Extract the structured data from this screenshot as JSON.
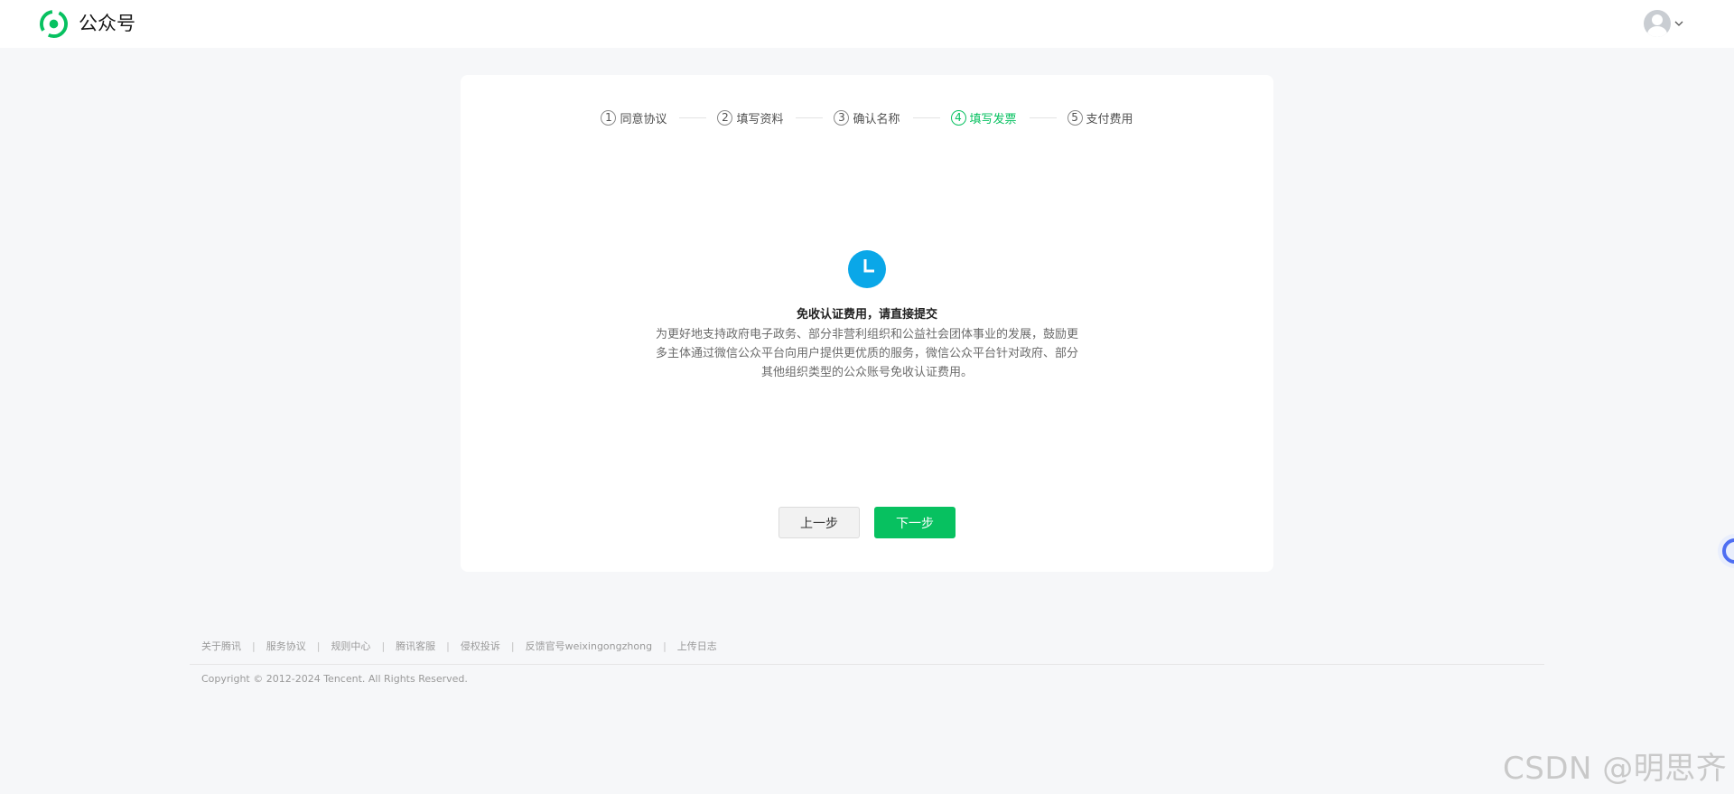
{
  "header": {
    "brand": "公众号",
    "logo_icon": "wechat-official-account-logo",
    "avatar_icon": "user-avatar-icon"
  },
  "steps": [
    {
      "num": "1",
      "label": "同意协议",
      "active": false
    },
    {
      "num": "2",
      "label": "填写资料",
      "active": false
    },
    {
      "num": "3",
      "label": "确认名称",
      "active": false
    },
    {
      "num": "4",
      "label": "填写发票",
      "active": true
    },
    {
      "num": "5",
      "label": "支付费用",
      "active": false
    }
  ],
  "message": {
    "icon": "clock-icon",
    "title": "免收认证费用，请直接提交",
    "description": "为更好地支持政府电子政务、部分非营利组织和公益社会团体事业的发展，鼓励更多主体通过微信公众平台向用户提供更优质的服务，微信公众平台针对政府、部分其他组织类型的公众账号免收认证费用。"
  },
  "buttons": {
    "prev": "上一步",
    "next": "下一步"
  },
  "footer": {
    "links": [
      "关于腾讯",
      "服务协议",
      "规则中心",
      "腾讯客服",
      "侵权投诉",
      "反馈官号weixingongzhong",
      "上传日志"
    ],
    "copyright": "Copyright © 2012-2024 Tencent. All Rights Reserved."
  },
  "watermark": "CSDN @明思齐",
  "colors": {
    "accent": "#07c160",
    "info_blue": "#0aa7e8",
    "page_bg": "#f6f7f9"
  }
}
